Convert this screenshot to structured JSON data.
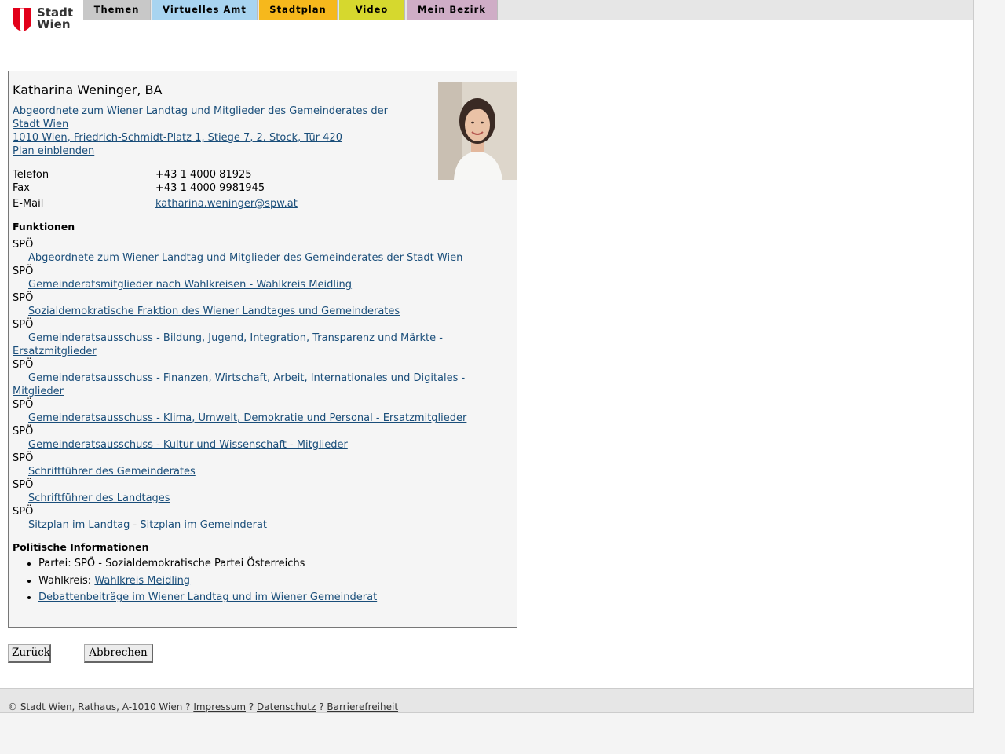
{
  "header": {
    "logo_line1": "Stadt",
    "logo_line2": "Wien",
    "nav": [
      {
        "label": "Themen",
        "color": "#c8c8c8"
      },
      {
        "label": "Virtuelles Amt",
        "color": "#a8d4f0"
      },
      {
        "label": "Stadtplan",
        "color": "#f6b81c"
      },
      {
        "label": "Video",
        "color": "#d6d82e"
      },
      {
        "label": "Mein Bezirk",
        "color": "#cfadc6"
      }
    ]
  },
  "person": {
    "name": "Katharina Weninger, BA",
    "role_link": "Abgeordnete zum Wiener Landtag und Mitglieder des Gemeinderates der Stadt Wien ",
    "address_link": "1010 Wien, Friedrich-Schmidt-Platz 1, Stiege 7, 2. Stock, Tür 420",
    "plan_link": "Plan einblenden",
    "contact": {
      "phone_label": "Telefon",
      "phone": "+43 1 4000 81925",
      "fax_label": "Fax",
      "fax": "+43 1 4000 9981945",
      "email_label": "E-Mail",
      "email": "katharina.weninger@spw.at"
    }
  },
  "functions": {
    "title": "Funktionen",
    "items": [
      {
        "party": "SPÖ",
        "link": "Abgeordnete zum Wiener Landtag und Mitglieder des Gemeinderates der Stadt Wien"
      },
      {
        "party": "SPÖ",
        "link": "Gemeinderatsmitglieder nach Wahlkreisen - Wahlkreis Meidling"
      },
      {
        "party": "SPÖ",
        "link": "Sozialdemokratische Fraktion des Wiener Landtages und Gemeinderates"
      },
      {
        "party": "SPÖ",
        "link": "Gemeinderatsausschuss - Bildung, Jugend, Integration, Transparenz und Märkte - Ersatzmitglieder"
      },
      {
        "party": "SPÖ",
        "link": "Gemeinderatsausschuss - Finanzen, Wirtschaft, Arbeit, Internationales und Digitales - Mitglieder"
      },
      {
        "party": "SPÖ",
        "link": "Gemeinderatsausschuss - Klima, Umwelt, Demokratie und Personal - Ersatzmitglieder"
      },
      {
        "party": "SPÖ",
        "link": "Gemeinderatsausschuss - Kultur und Wissenschaft - Mitglieder"
      },
      {
        "party": "SPÖ",
        "link": "Schriftführer des Gemeinderates"
      },
      {
        "party": "SPÖ",
        "link": "Schriftführer des Landtages"
      }
    ],
    "last_party": "SPÖ",
    "seat_plan_landtag": "Sitzplan im Landtag",
    "seat_plan_separator": " - ",
    "seat_plan_gemeinderat": "Sitzplan im Gemeinderat"
  },
  "political": {
    "title": "Politische Informationen",
    "party_text": "Partei: SPÖ - Sozialdemokratische Partei Österreichs",
    "district_label": "Wahlkreis: ",
    "district_link": "Wahlkreis Meidling",
    "debates_link": "Debattenbeiträge im Wiener Landtag und im Wiener Gemeinderat"
  },
  "buttons": {
    "back": "Zurück",
    "cancel": "Abbrechen"
  },
  "footer": {
    "copyright": "© Stadt Wien, Rathaus, A-1010 Wien ? ",
    "impressum": "Impressum",
    "sep1": " ? ",
    "datenschutz": "Datenschutz",
    "sep2": " ? ",
    "barrierefreiheit": "Barrierefreiheit"
  },
  "colors": {
    "link": "#1a4e7a",
    "logo_red": "#e2001a"
  }
}
